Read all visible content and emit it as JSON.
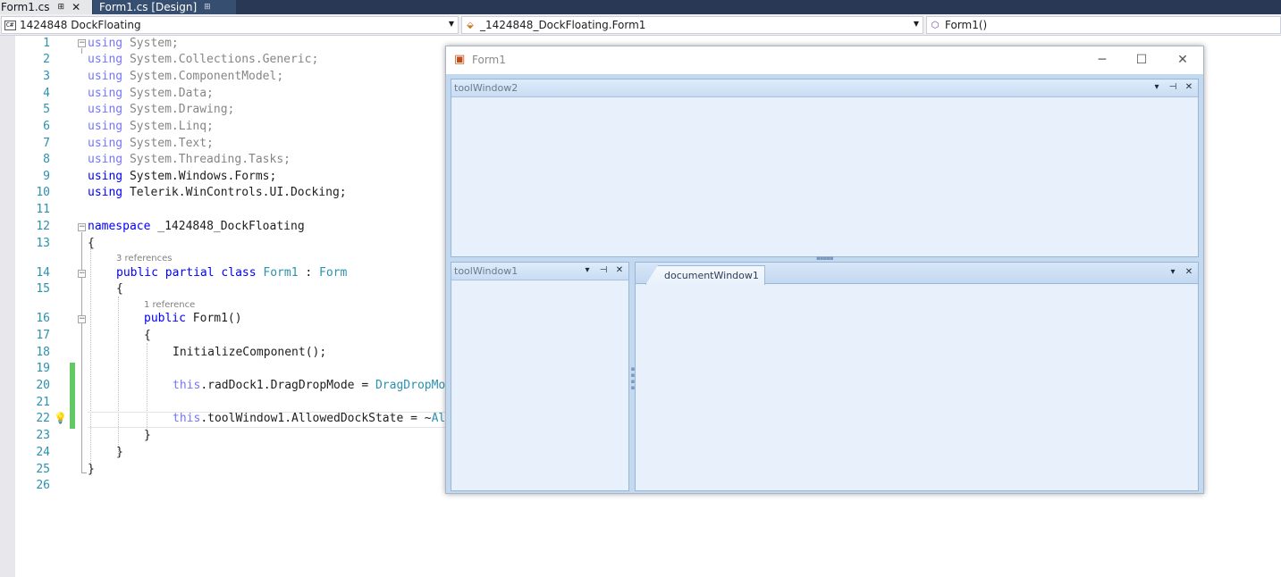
{
  "tabs": {
    "active": {
      "label": "Form1.cs",
      "pin": "⊞",
      "close": "✕"
    },
    "inactive": {
      "label": "Form1.cs [Design]",
      "pin": "⊞"
    }
  },
  "navbar": {
    "project": {
      "badge": "C#",
      "label": "1424848 DockFloating"
    },
    "type": {
      "label": "_1424848_DockFloating.Form1"
    },
    "member": {
      "label": "Form1()"
    }
  },
  "codelens": {
    "class_refs": "3 references",
    "ctor_refs": "1 reference"
  },
  "code": {
    "l1": {
      "num": "1",
      "kw": "using",
      "rest": " System;"
    },
    "l2": {
      "num": "2",
      "kw": "using",
      "rest": " System.Collections.Generic;"
    },
    "l3": {
      "num": "3",
      "kw": "using",
      "rest": " System.ComponentModel;"
    },
    "l4": {
      "num": "4",
      "kw": "using",
      "rest": " System.Data;"
    },
    "l5": {
      "num": "5",
      "kw": "using",
      "rest": " System.Drawing;"
    },
    "l6": {
      "num": "6",
      "kw": "using",
      "rest": " System.Linq;"
    },
    "l7": {
      "num": "7",
      "kw": "using",
      "rest": " System.Text;"
    },
    "l8": {
      "num": "8",
      "kw": "using",
      "rest": " System.Threading.Tasks;"
    },
    "l9": {
      "num": "9",
      "kw": "using",
      "rest": " System.Windows.Forms;"
    },
    "l10": {
      "num": "10",
      "kw": "using",
      "rest": " Telerik.WinControls.UI.Docking;"
    },
    "l11": {
      "num": "11"
    },
    "l12": {
      "num": "12",
      "kw": "namespace",
      "rest": " _1424848_DockFloating"
    },
    "l13": {
      "num": "13",
      "text": "{"
    },
    "l14": {
      "num": "14",
      "kw1": "public",
      "kw2": " partial",
      "kw3": " class",
      "ty": " Form1",
      "sep": " : ",
      "ty2": "Form"
    },
    "l15": {
      "num": "15",
      "text": "{"
    },
    "l16": {
      "num": "16",
      "kw": "public",
      "rest": " Form1()"
    },
    "l17": {
      "num": "17",
      "text": "{"
    },
    "l18": {
      "num": "18",
      "text": "InitializeComponent();"
    },
    "l19": {
      "num": "19"
    },
    "l20": {
      "num": "20",
      "kw": "this",
      "rest": ".radDock1.DragDropMode = ",
      "ty": "DragDropMo"
    },
    "l21": {
      "num": "21"
    },
    "l22": {
      "num": "22",
      "kw": "this",
      "rest": ".toolWindow1.AllowedDockState = ~",
      "ty": "Al"
    },
    "l23": {
      "num": "23",
      "text": "}"
    },
    "l24": {
      "num": "24",
      "text": "}"
    },
    "l25": {
      "num": "25",
      "text": "}"
    },
    "l26": {
      "num": "26"
    }
  },
  "form": {
    "title": "Form1",
    "minimize": "─",
    "maximize": "☐",
    "close": "✕",
    "tool_window_2": {
      "title": "toolWindow2",
      "menu": "▾",
      "pin": "⊣",
      "close": "✕"
    },
    "tool_window_1": {
      "title": "toolWindow1",
      "menu": "▾",
      "pin": "⊣",
      "close": "✕"
    },
    "document_window_1": {
      "title": "documentWindow1",
      "menu": "▾",
      "close": "✕"
    }
  },
  "colors": {
    "keyword": "#0000ff",
    "type": "#2b91af",
    "line_number": "#2b91af",
    "change_bar": "#63c963",
    "dock_background": "#c3d9f0"
  },
  "icons": {
    "project": "csharp-project-icon",
    "type": "class-icon",
    "member": "method-icon",
    "lightbulb": "lightbulb-icon",
    "form": "form-icon"
  }
}
